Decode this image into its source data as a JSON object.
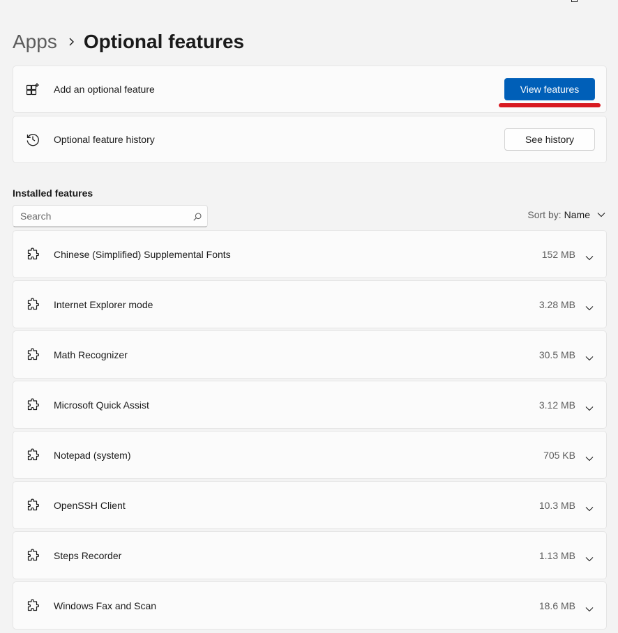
{
  "breadcrumb": {
    "parent": "Apps",
    "current": "Optional features"
  },
  "add_feature": {
    "label": "Add an optional feature",
    "button": "View features",
    "icon": "add-app-icon"
  },
  "history": {
    "label": "Optional feature history",
    "button": "See history",
    "icon": "history-icon"
  },
  "installed": {
    "title": "Installed features",
    "search_placeholder": "Search",
    "sort_label": "Sort by:",
    "sort_value": "Name",
    "items": [
      {
        "name": "Chinese (Simplified) Supplemental Fonts",
        "size": "152 MB"
      },
      {
        "name": "Internet Explorer mode",
        "size": "3.28 MB"
      },
      {
        "name": "Math Recognizer",
        "size": "30.5 MB"
      },
      {
        "name": "Microsoft Quick Assist",
        "size": "3.12 MB"
      },
      {
        "name": "Notepad (system)",
        "size": "705 KB"
      },
      {
        "name": "OpenSSH Client",
        "size": "10.3 MB"
      },
      {
        "name": "Steps Recorder",
        "size": "1.13 MB"
      },
      {
        "name": "Windows Fax and Scan",
        "size": "18.6 MB"
      }
    ]
  },
  "colors": {
    "accent": "#005fb8",
    "annotation": "#d81a21",
    "background": "#f3f3f3",
    "card": "#fbfbfb"
  }
}
